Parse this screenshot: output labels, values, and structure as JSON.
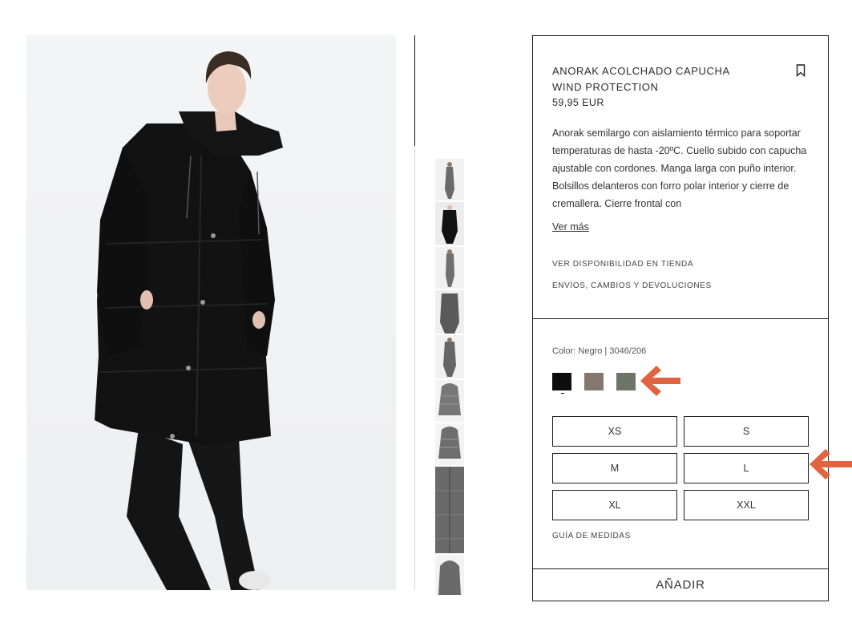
{
  "product": {
    "title": "ANORAK ACOLCHADO CAPUCHA WIND PROTECTION",
    "price": "59,95 EUR",
    "description": "Anorak semilargo con aislamiento térmico para soportar temperaturas de hasta -20ºC. Cuello subido con capucha ajustable con cordones. Manga larga con puño interior. Bolsillos delanteros con forro polar interior y cierre de cremallera. Cierre frontal con",
    "more_label": "Ver más",
    "store_availability": "VER DISPONIBILIDAD EN TIENDA",
    "shipping": "ENVÍOS, CAMBIOS Y DEVOLUCIONES",
    "color_label": "Color: Negro | 3046/206",
    "swatches": [
      {
        "name": "Negro",
        "color": "#0d0d0d"
      },
      {
        "name": "Topo",
        "color": "#85776d"
      },
      {
        "name": "Verde",
        "color": "#6d7468"
      }
    ],
    "sizes": [
      "XS",
      "S",
      "M",
      "L",
      "XL",
      "XXL"
    ],
    "size_guide": "GUÍA DE MEDIDAS",
    "add_label": "AÑADIR"
  },
  "icons": {
    "bookmark": "bookmark-icon",
    "annotation_arrow": "left-arrow-icon"
  },
  "colors": {
    "accent_arrow": "#e0643f",
    "border": "#1c1c1c"
  }
}
